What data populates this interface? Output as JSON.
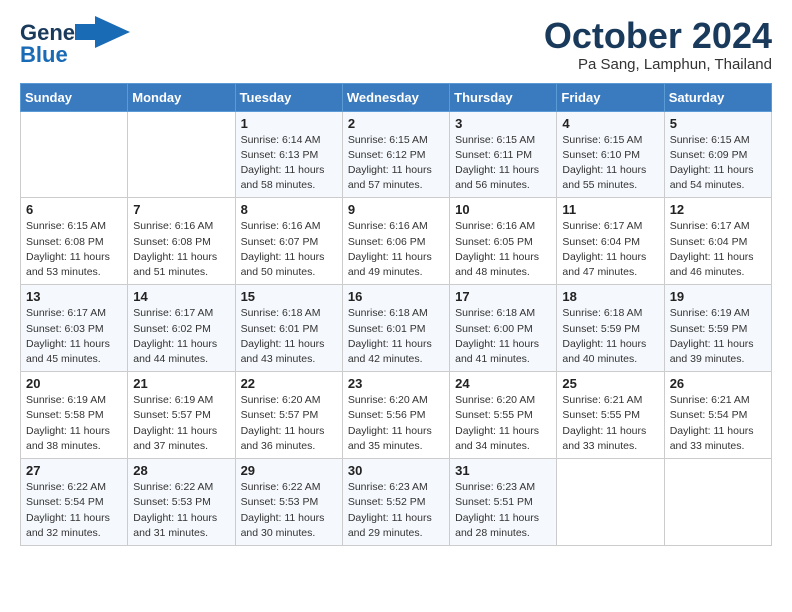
{
  "header": {
    "logo_line1": "General",
    "logo_line2": "Blue",
    "month_title": "October 2024",
    "location": "Pa Sang, Lamphun, Thailand"
  },
  "weekdays": [
    "Sunday",
    "Monday",
    "Tuesday",
    "Wednesday",
    "Thursday",
    "Friday",
    "Saturday"
  ],
  "weeks": [
    [
      {
        "day": "",
        "info": ""
      },
      {
        "day": "",
        "info": ""
      },
      {
        "day": "1",
        "info": "Sunrise: 6:14 AM\nSunset: 6:13 PM\nDaylight: 11 hours and 58 minutes."
      },
      {
        "day": "2",
        "info": "Sunrise: 6:15 AM\nSunset: 6:12 PM\nDaylight: 11 hours and 57 minutes."
      },
      {
        "day": "3",
        "info": "Sunrise: 6:15 AM\nSunset: 6:11 PM\nDaylight: 11 hours and 56 minutes."
      },
      {
        "day": "4",
        "info": "Sunrise: 6:15 AM\nSunset: 6:10 PM\nDaylight: 11 hours and 55 minutes."
      },
      {
        "day": "5",
        "info": "Sunrise: 6:15 AM\nSunset: 6:09 PM\nDaylight: 11 hours and 54 minutes."
      }
    ],
    [
      {
        "day": "6",
        "info": "Sunrise: 6:15 AM\nSunset: 6:08 PM\nDaylight: 11 hours and 53 minutes."
      },
      {
        "day": "7",
        "info": "Sunrise: 6:16 AM\nSunset: 6:08 PM\nDaylight: 11 hours and 51 minutes."
      },
      {
        "day": "8",
        "info": "Sunrise: 6:16 AM\nSunset: 6:07 PM\nDaylight: 11 hours and 50 minutes."
      },
      {
        "day": "9",
        "info": "Sunrise: 6:16 AM\nSunset: 6:06 PM\nDaylight: 11 hours and 49 minutes."
      },
      {
        "day": "10",
        "info": "Sunrise: 6:16 AM\nSunset: 6:05 PM\nDaylight: 11 hours and 48 minutes."
      },
      {
        "day": "11",
        "info": "Sunrise: 6:17 AM\nSunset: 6:04 PM\nDaylight: 11 hours and 47 minutes."
      },
      {
        "day": "12",
        "info": "Sunrise: 6:17 AM\nSunset: 6:04 PM\nDaylight: 11 hours and 46 minutes."
      }
    ],
    [
      {
        "day": "13",
        "info": "Sunrise: 6:17 AM\nSunset: 6:03 PM\nDaylight: 11 hours and 45 minutes."
      },
      {
        "day": "14",
        "info": "Sunrise: 6:17 AM\nSunset: 6:02 PM\nDaylight: 11 hours and 44 minutes."
      },
      {
        "day": "15",
        "info": "Sunrise: 6:18 AM\nSunset: 6:01 PM\nDaylight: 11 hours and 43 minutes."
      },
      {
        "day": "16",
        "info": "Sunrise: 6:18 AM\nSunset: 6:01 PM\nDaylight: 11 hours and 42 minutes."
      },
      {
        "day": "17",
        "info": "Sunrise: 6:18 AM\nSunset: 6:00 PM\nDaylight: 11 hours and 41 minutes."
      },
      {
        "day": "18",
        "info": "Sunrise: 6:18 AM\nSunset: 5:59 PM\nDaylight: 11 hours and 40 minutes."
      },
      {
        "day": "19",
        "info": "Sunrise: 6:19 AM\nSunset: 5:59 PM\nDaylight: 11 hours and 39 minutes."
      }
    ],
    [
      {
        "day": "20",
        "info": "Sunrise: 6:19 AM\nSunset: 5:58 PM\nDaylight: 11 hours and 38 minutes."
      },
      {
        "day": "21",
        "info": "Sunrise: 6:19 AM\nSunset: 5:57 PM\nDaylight: 11 hours and 37 minutes."
      },
      {
        "day": "22",
        "info": "Sunrise: 6:20 AM\nSunset: 5:57 PM\nDaylight: 11 hours and 36 minutes."
      },
      {
        "day": "23",
        "info": "Sunrise: 6:20 AM\nSunset: 5:56 PM\nDaylight: 11 hours and 35 minutes."
      },
      {
        "day": "24",
        "info": "Sunrise: 6:20 AM\nSunset: 5:55 PM\nDaylight: 11 hours and 34 minutes."
      },
      {
        "day": "25",
        "info": "Sunrise: 6:21 AM\nSunset: 5:55 PM\nDaylight: 11 hours and 33 minutes."
      },
      {
        "day": "26",
        "info": "Sunrise: 6:21 AM\nSunset: 5:54 PM\nDaylight: 11 hours and 33 minutes."
      }
    ],
    [
      {
        "day": "27",
        "info": "Sunrise: 6:22 AM\nSunset: 5:54 PM\nDaylight: 11 hours and 32 minutes."
      },
      {
        "day": "28",
        "info": "Sunrise: 6:22 AM\nSunset: 5:53 PM\nDaylight: 11 hours and 31 minutes."
      },
      {
        "day": "29",
        "info": "Sunrise: 6:22 AM\nSunset: 5:53 PM\nDaylight: 11 hours and 30 minutes."
      },
      {
        "day": "30",
        "info": "Sunrise: 6:23 AM\nSunset: 5:52 PM\nDaylight: 11 hours and 29 minutes."
      },
      {
        "day": "31",
        "info": "Sunrise: 6:23 AM\nSunset: 5:51 PM\nDaylight: 11 hours and 28 minutes."
      },
      {
        "day": "",
        "info": ""
      },
      {
        "day": "",
        "info": ""
      }
    ]
  ]
}
